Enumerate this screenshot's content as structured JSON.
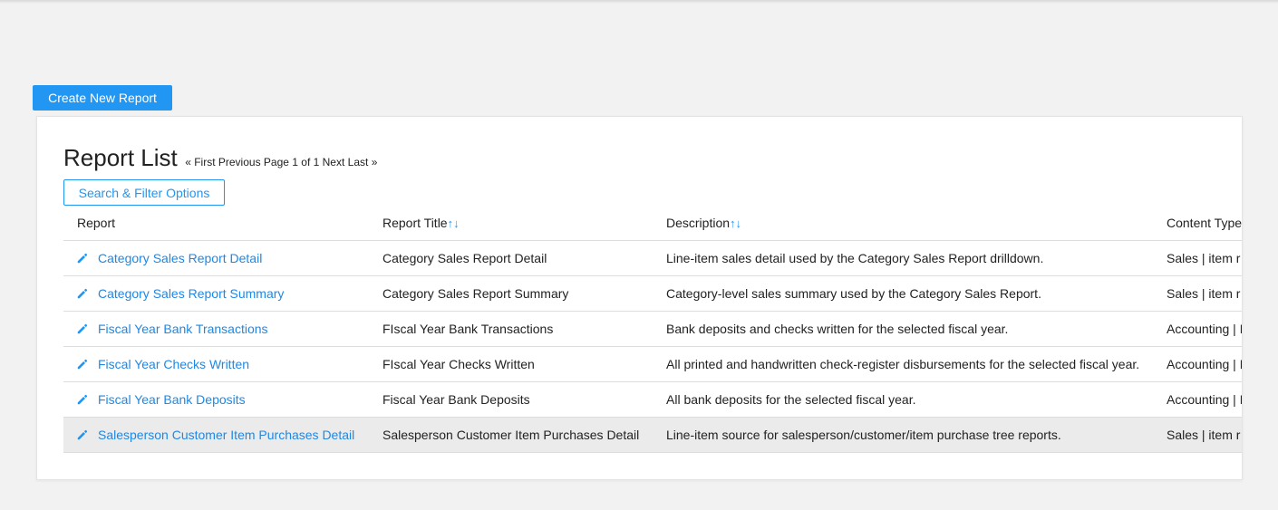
{
  "toolbar": {
    "create_label": "Create New Report"
  },
  "card": {
    "title": "Report List",
    "pager": {
      "first": "« First",
      "previous": "Previous",
      "status": "Page 1 of 1",
      "next": "Next",
      "last": "Last »"
    },
    "filter_label": "Search & Filter Options"
  },
  "table": {
    "headers": {
      "report": "Report",
      "title": "Report Title",
      "description": "Description",
      "content_type": "Content Type"
    },
    "sort_glyph": "↑↓",
    "rows": [
      {
        "report": "Category Sales Report Detail",
        "title": "Category Sales Report Detail",
        "description": "Line-item sales detail used by the Category Sales Report drilldown.",
        "content_type": "Sales | item r"
      },
      {
        "report": "Category Sales Report Summary",
        "title": "Category Sales Report Summary",
        "description": "Category-level sales summary used by the Category Sales Report.",
        "content_type": "Sales | item r"
      },
      {
        "report": "Fiscal Year Bank Transactions",
        "title": "FIscal Year Bank Transactions",
        "description": "Bank deposits and checks written for the selected fiscal year.",
        "content_type": "Accounting | I"
      },
      {
        "report": "Fiscal Year Checks Written",
        "title": "FIscal Year Checks Written",
        "description": "All printed and handwritten check-register disbursements for the selected fiscal year.",
        "content_type": "Accounting | I"
      },
      {
        "report": "Fiscal Year Bank Deposits",
        "title": "Fiscal Year Bank Deposits",
        "description": "All bank deposits for the selected fiscal year.",
        "content_type": "Accounting | I"
      },
      {
        "report": "Salesperson Customer Item Purchases Detail",
        "title": "Salesperson Customer Item Purchases Detail",
        "description": "Line-item source for salesperson/customer/item purchase tree reports.",
        "content_type": "Sales | item r"
      }
    ]
  },
  "icons": {
    "edit": "pencil-icon"
  },
  "colors": {
    "accent": "#2196f3",
    "link": "#1e88e5",
    "highlight_row": "#ebebeb"
  }
}
